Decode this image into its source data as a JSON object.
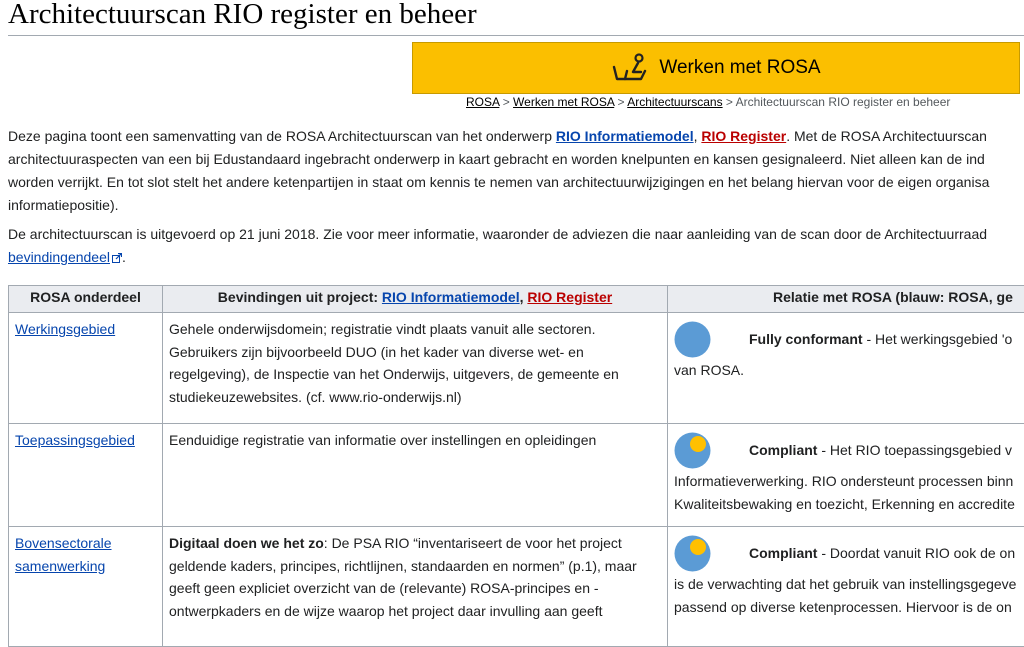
{
  "page": {
    "title": "Architectuurscan RIO register en beheer"
  },
  "banner": {
    "label": "Werken met ROSA",
    "icon": "person-at-desk-icon",
    "color": "#fbbf00"
  },
  "breadcrumb": {
    "item1": "ROSA",
    "sep1": " > ",
    "item2": "Werken met ROSA",
    "sep2": " > ",
    "item3": "Architectuurscans",
    "sep3": " > ",
    "current": "Architectuurscan RIO register en beheer"
  },
  "intro": {
    "line1_pre": "Deze pagina toont een samenvatting van de ROSA Architectuurscan van het onderwerp ",
    "link1": "RIO Informatiemodel",
    "comma": ", ",
    "link2": "RIO Register",
    "line1_post": ". Met de ROSA Architectuurscan",
    "line2": "architectuuraspecten van een bij Edustandaard ingebracht onderwerp in kaart gebracht en worden knelpunten en kansen gesignaleerd. Niet alleen kan de ind",
    "line3": "worden verrijkt. En tot slot stelt het andere ketenpartijen in staat om kennis te nemen van architectuurwijzigingen en het belang hiervan voor de eigen organisa",
    "line4": "informatiepositie)."
  },
  "para2": {
    "line1": "De architectuurscan is uitgevoerd op 21 juni 2018. Zie voor meer informatie, waaronder de adviezen die naar aanleiding van de scan door de Architectuurraad",
    "link": "bevindingendeel",
    "line2_post": "."
  },
  "table": {
    "headers": {
      "col1": "ROSA onderdeel",
      "col2_pre": "Bevindingen uit project: ",
      "col2_link1": "RIO Informatiemodel",
      "col2_comma": ", ",
      "col2_link2": "RIO Register",
      "col3": "Relatie met ROSA (blauw: ROSA, ge"
    },
    "rows": [
      {
        "name": "Werkingsgebied",
        "finding_l1": "Gehele onderwijsdomein; registratie vindt plaats vanuit alle sectoren.",
        "finding_l2": "Gebruikers zijn bijvoorbeeld DUO (in het kader van diverse wet- en",
        "finding_l3": "regelgeving), de Inspectie van het Onderwijs, uitgevers, de gemeente en",
        "finding_l4": "studiekeuzewebsites. (cf. www.rio-onderwijs.nl)",
        "rel_status": "Fully conformant",
        "rel_text": " - Het werkingsgebied 'o",
        "rel_l2": "van ROSA."
      },
      {
        "name": "Toepassingsgebied",
        "finding_l1": "Eenduidige registratie van informatie over instellingen en opleidingen",
        "rel_status": "Compliant",
        "rel_text": " - Het RIO toepassingsgebied v",
        "rel_l2": "Informatieverwerking. RIO ondersteunt processen binn",
        "rel_l3": "Kwaliteitsbewaking en toezicht, Erkenning en accredite"
      },
      {
        "name_l1": "Bovensectorale",
        "name_l2": "samenwerking",
        "finding_bold": "Digitaal doen we het zo",
        "finding_l1": ": De PSA RIO “inventariseert de voor het project",
        "finding_l2": "geldende kaders, principes, richtlijnen, standaarden en normen” (p.1), maar",
        "finding_l3": "geeft geen expliciet overzicht van de (relevante) ROSA-principes en -",
        "finding_l4": "ontwerpkaders en de wijze waarop het project daar invulling aan geeft",
        "rel_status": "Compliant",
        "rel_text": " - Doordat vanuit RIO ook de on",
        "rel_l2": "is de verwachting dat het gebruik van instellingsgegeve",
        "rel_l3": "passend op diverse ketenprocessen. Hiervoor is de on"
      }
    ]
  },
  "colors": {
    "link": "#0645ad",
    "redlink": "#ba0000",
    "circle_blue": "#5b9bd5",
    "circle_yellow": "#ffc000"
  }
}
